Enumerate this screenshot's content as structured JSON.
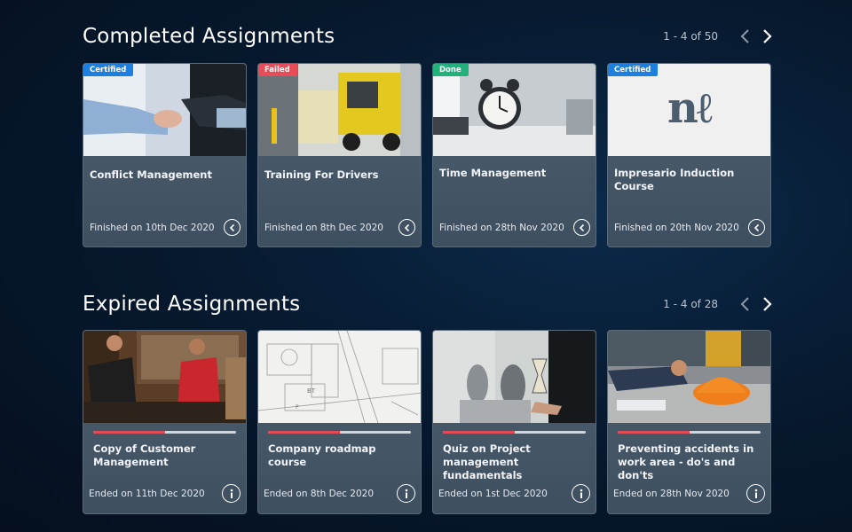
{
  "completed": {
    "title": "Completed Assignments",
    "pager_text": "1 - 4 of 50",
    "cards": [
      {
        "badge": "Certified",
        "title": "Conflict Management",
        "footer": "Finished on 10th Dec 2020"
      },
      {
        "badge": "Failed",
        "title": "Training For Drivers",
        "footer": "Finished on 8th Dec 2020"
      },
      {
        "badge": "Done",
        "title": "Time Management",
        "footer": "Finished on 28th Nov 2020"
      },
      {
        "badge": "Certified",
        "title": "Impresario Induction Course",
        "footer": "Finished on 20th Nov 2020",
        "logo_text": "nℓ"
      }
    ]
  },
  "expired": {
    "title": "Expired Assignments",
    "pager_text": "1 - 4 of 28",
    "cards": [
      {
        "title": "Copy of Customer Management",
        "footer": "Ended on 11th Dec 2020",
        "progress": 0.5
      },
      {
        "title": "Company roadmap course",
        "footer": "Ended on 8th Dec 2020",
        "progress": 0.5
      },
      {
        "title": "Quiz on Project management fundamentals",
        "footer": "Ended on 1st Dec 2020",
        "progress": 0.5
      },
      {
        "title": "Preventing accidents in work area - do's and don'ts",
        "footer": "Ended on 28th Nov 2020",
        "progress": 0.5
      }
    ]
  },
  "colors": {
    "accent_red": "#e24b55",
    "certified": "#1d7fe0",
    "failed": "#e74c57",
    "done": "#20b27a"
  },
  "icons": {
    "prev": "chevron-left-icon",
    "next": "chevron-right-icon",
    "revisit": "back-arrow-circle-icon",
    "info": "info-circle-icon"
  }
}
